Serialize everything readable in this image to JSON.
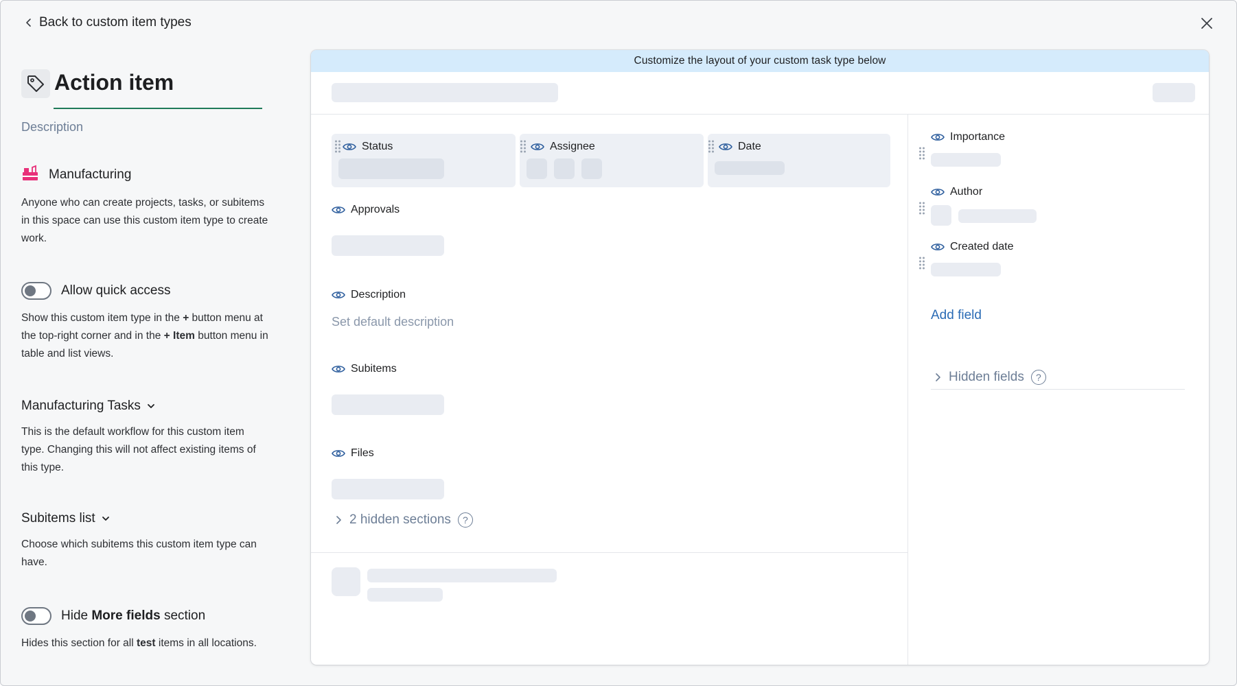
{
  "header": {
    "back_label": "Back to custom item types"
  },
  "left_panel": {
    "title": "Action item",
    "description_link": "Description",
    "space": {
      "name": "Manufacturing",
      "text": "Anyone who can create projects, tasks, or subitems in this space can use this custom item type to create work."
    },
    "quick_access": {
      "label": "Allow quick access",
      "text_1": "Show this custom item type in the ",
      "text_plus": "+",
      "text_2": " button menu at the top-right corner and in the ",
      "text_item": "+ Item",
      "text_3": " button menu in table and list views."
    },
    "workflow": {
      "label": "Manufacturing Tasks",
      "text": "This is the default workflow for this custom item type. Changing this will not affect existing items of this type."
    },
    "subitems_list": {
      "label": "Subitems list",
      "text": "Choose which subitems this custom item type can have."
    },
    "hide_more": {
      "label_1": "Hide ",
      "label_bold": "More fields",
      "label_2": " section",
      "text_1": "Hides this section for all ",
      "text_bold": "test",
      "text_2": " items in all locations."
    }
  },
  "card": {
    "banner": "Customize the layout of your custom task type below",
    "top_fields": [
      {
        "label": "Status"
      },
      {
        "label": "Assignee"
      },
      {
        "label": "Date"
      }
    ],
    "sections": {
      "approvals": "Approvals",
      "description": "Description",
      "description_placeholder": "Set default description",
      "subitems": "Subitems",
      "files": "Files"
    },
    "hidden_sections": "2 hidden sections",
    "side_fields": [
      {
        "label": "Importance"
      },
      {
        "label": "Author"
      },
      {
        "label": "Created date"
      }
    ],
    "add_field": "Add field",
    "hidden_fields": "Hidden fields"
  },
  "colors": {
    "accent_underline": "#1f7a58",
    "banner_bg": "#d5ebfc",
    "link": "#2a6bb5",
    "muted": "#6d7e96",
    "skeleton": "#e9ecf2",
    "eye_icon": "#2f5f9e"
  },
  "icons": [
    "chevron-left-icon",
    "close-icon",
    "tag-icon",
    "manufacturing-icon",
    "chevron-down-icon",
    "drag-handle-icon",
    "eye-icon",
    "chevron-right-icon",
    "help-icon"
  ]
}
